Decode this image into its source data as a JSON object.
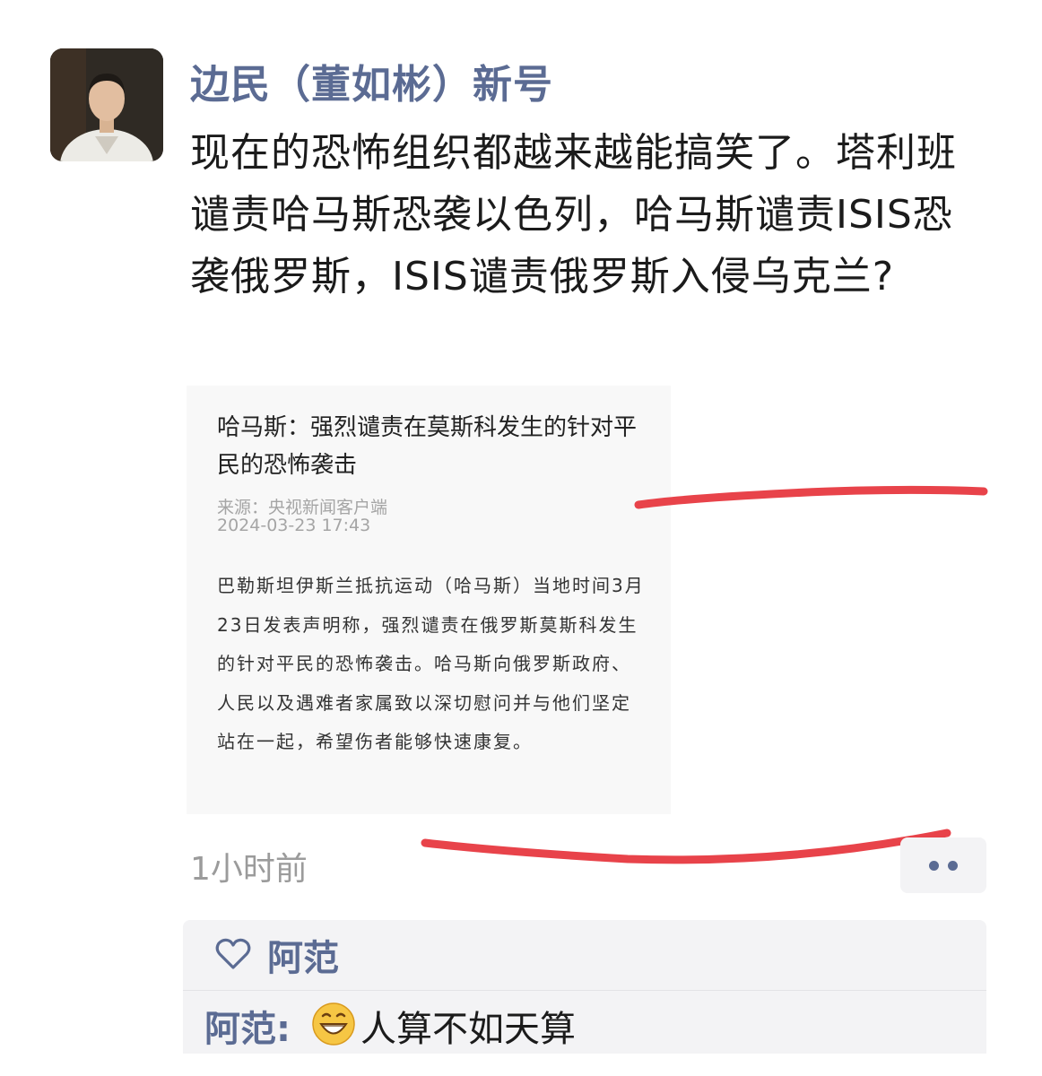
{
  "post": {
    "author": "边民（董如彬）新号",
    "text": "现在的恐怖组织都越来越能搞笑了。塔利班谴责哈马斯恐袭以色列，哈马斯谴责ISIS恐袭俄罗斯，ISIS谴责俄罗斯入侵乌克兰?",
    "time": "1小时前"
  },
  "article": {
    "title": "哈马斯：强烈谴责在莫斯科发生的针对平民的恐怖袭击",
    "source": "来源：央视新闻客户端",
    "date": "2024-03-23 17:43",
    "body": "巴勒斯坦伊斯兰抵抗运动（哈马斯）当地时间3月23日发表声明称，强烈谴责在俄罗斯莫斯科发生的针对平民的恐怖袭击。哈马斯向俄罗斯政府、人民以及遇难者家属致以深切慰问并与他们坚定站在一起，希望伤者能够快速康复。"
  },
  "likes": {
    "names": "阿范"
  },
  "comments": [
    {
      "author": "阿范:",
      "emoji": "grinning-emoji",
      "text": "人算不如天算"
    }
  ],
  "colors": {
    "name_blue": "#5b6b93",
    "underline_red": "#e8434a",
    "panel_bg": "#f3f3f5"
  }
}
